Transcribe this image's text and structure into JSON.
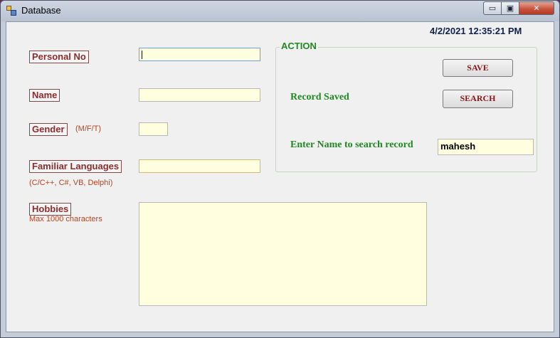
{
  "window": {
    "title": "Database",
    "min_symbol": "▭",
    "max_symbol": "▣",
    "close_symbol": "✕"
  },
  "form": {
    "timestamp": "4/2/2021 12:35:21 PM",
    "personal_no": {
      "label": "Personal No",
      "value": ""
    },
    "name": {
      "label": "Name",
      "value": ""
    },
    "gender": {
      "label": "Gender",
      "hint": "(M/F/T)",
      "value": ""
    },
    "languages": {
      "label": "Familiar Languages",
      "hint": "(C/C++, C#, VB, Delphi)",
      "value": ""
    },
    "hobbies": {
      "label": "Hobbies",
      "hint": "Max 1000 characters",
      "value": ""
    }
  },
  "action": {
    "group_title": "ACTION",
    "save_label": "SAVE",
    "search_label": "SEARCH",
    "status_text": "Record Saved",
    "search_prompt": "Enter Name to search record",
    "search_value": "mahesh"
  },
  "colors": {
    "field_bg": "#ffffe0",
    "label_color": "#8b2d2d",
    "accent_green": "#1f8a1f"
  }
}
